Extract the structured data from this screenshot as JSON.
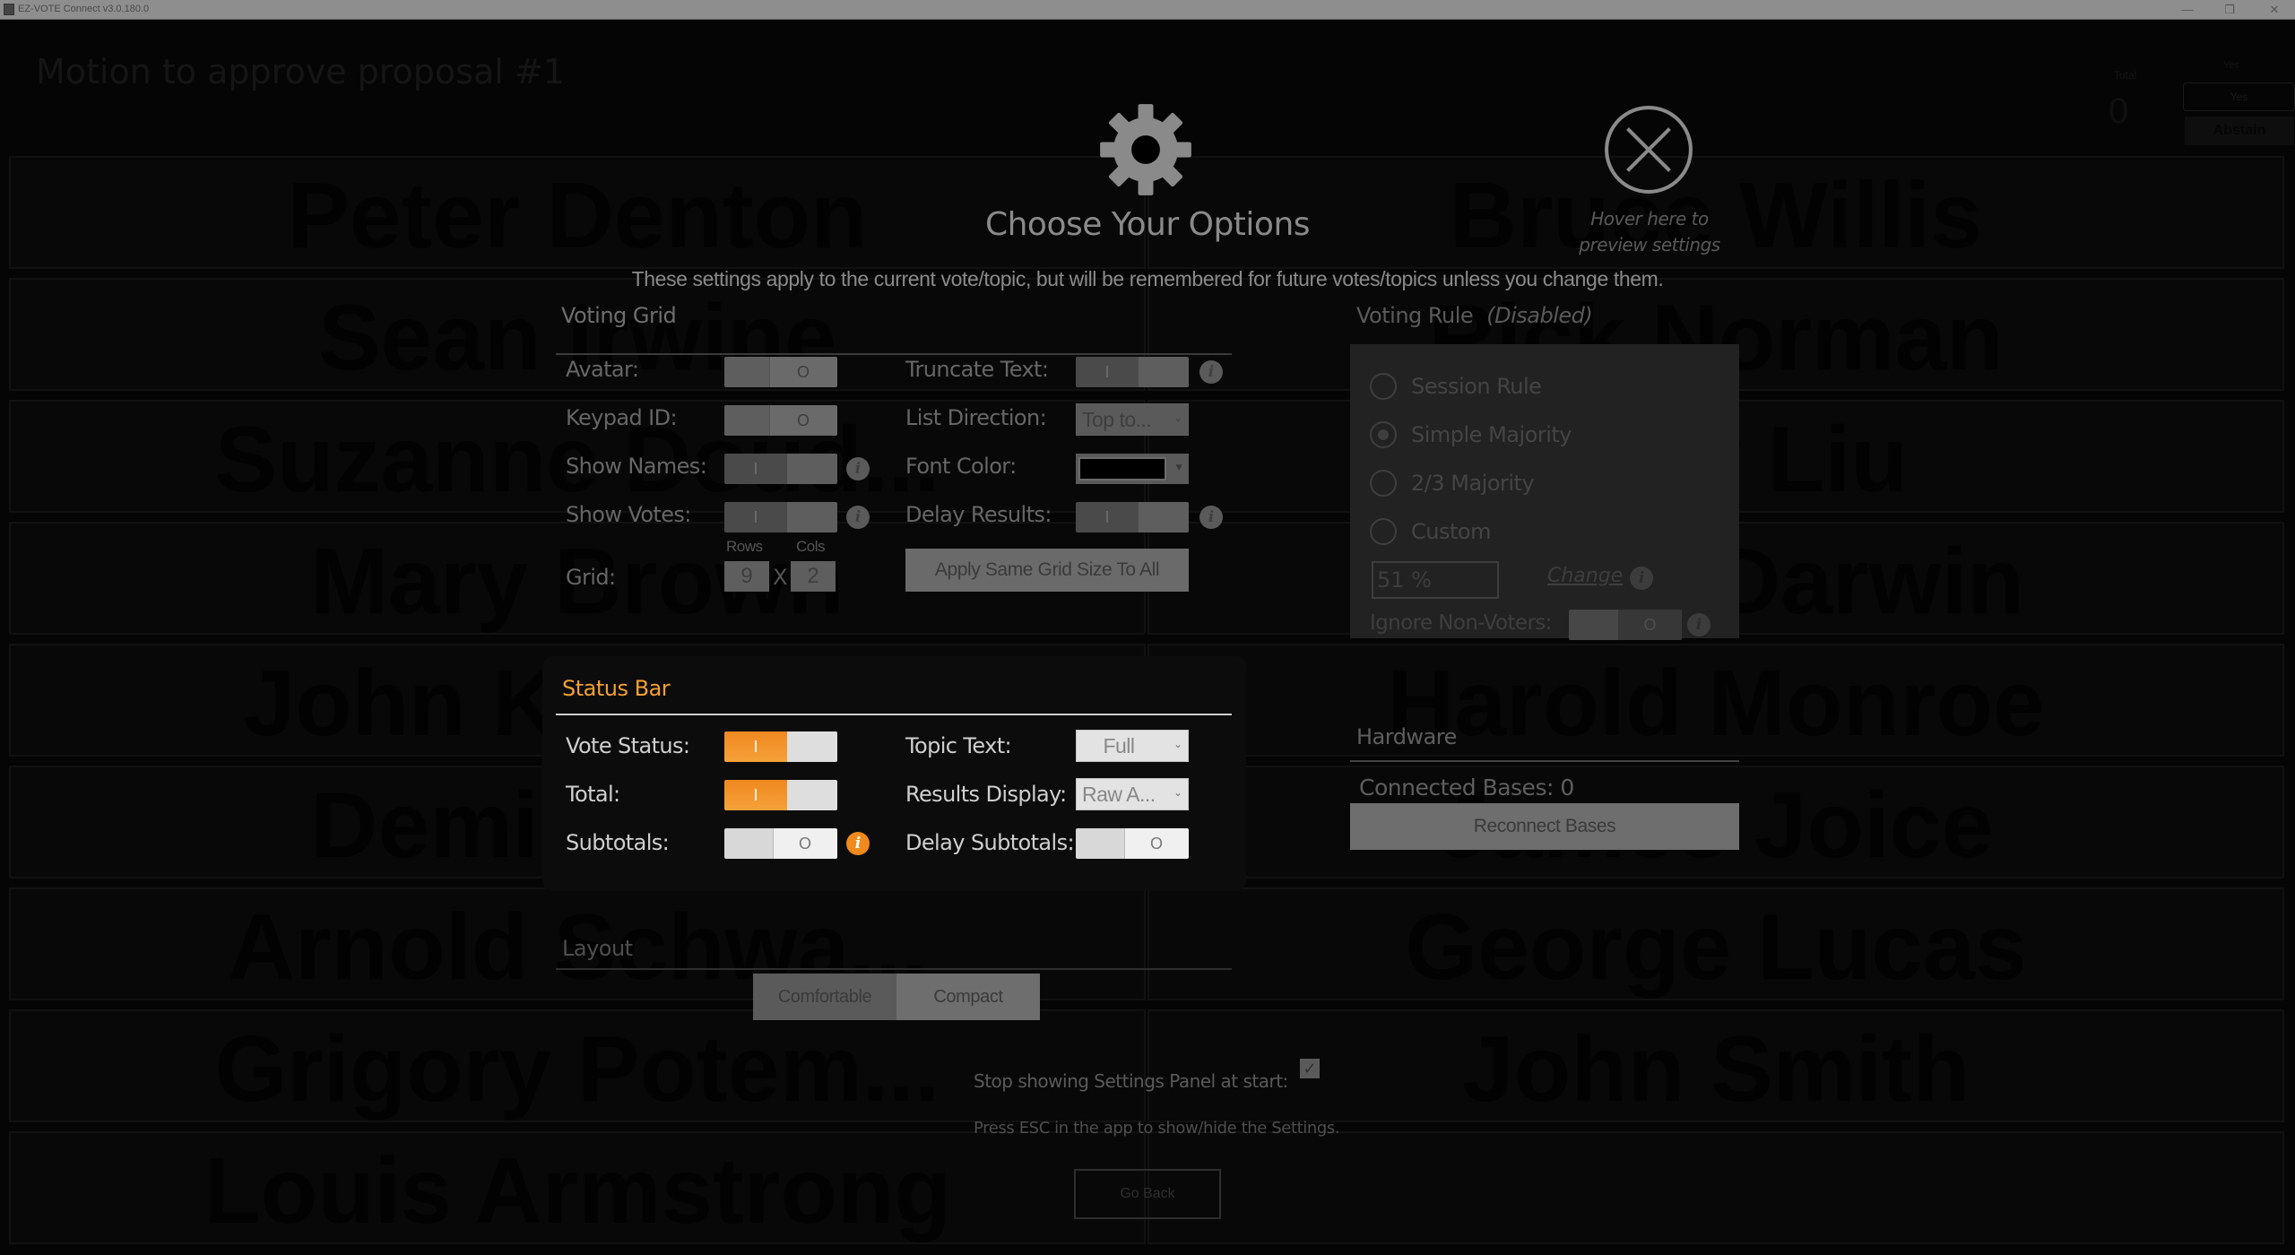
{
  "window": {
    "title": "EZ-VOTE Connect v3.0.180.0",
    "controls": {
      "minimize": "—",
      "maximize": "❐",
      "close": "✕"
    }
  },
  "background_app": {
    "topic": "Motion to approve proposal #1",
    "status": {
      "total_label": "Total",
      "total_value": "0",
      "yes_label": "Yes",
      "yes_field": "Yes",
      "abstain_label": "Abstain"
    },
    "grid_names_left": [
      "Peter Denton",
      "Sean Irwine",
      "Suzanne Doud...",
      "Mary Brown",
      "John Krasinski",
      "Demi Moore",
      "Arnold Schwa...",
      "Grigory Potem...",
      "Louis Armstrong"
    ],
    "grid_names_right": [
      "Bruce Willis",
      "Rick Norman",
      "Lucy Liu",
      "Nancy Darwin",
      "Harold Monroe",
      "James Joice",
      "George Lucas",
      "John Smith",
      ""
    ]
  },
  "settings": {
    "gear_icon": "gear-icon",
    "close_icon": "close-circle-icon",
    "heading": "Choose Your Options",
    "hover_hint": "Hover here to preview settings",
    "subtitle": "These settings apply to the current vote/topic, but will be remembered for future votes/topics unless you change them.",
    "voting_grid": {
      "title": "Voting Grid",
      "avatar": {
        "label": "Avatar:",
        "state": "off",
        "glyph": "O"
      },
      "keypad_id": {
        "label": "Keypad ID:",
        "state": "off",
        "glyph": "O"
      },
      "show_names": {
        "label": "Show Names:",
        "state": "on",
        "glyph": "I"
      },
      "show_votes": {
        "label": "Show Votes:",
        "state": "on",
        "glyph": "I"
      },
      "grid": {
        "label": "Grid:",
        "rows_label": "Rows",
        "cols_label": "Cols",
        "rows": "9",
        "cols": "2",
        "times": "X"
      },
      "truncate_text": {
        "label": "Truncate Text:",
        "state": "on",
        "glyph": "I"
      },
      "list_direction": {
        "label": "List Direction:",
        "value": "Top to..."
      },
      "font_color": {
        "label": "Font Color:",
        "value": "#000000"
      },
      "delay_results": {
        "label": "Delay Results:",
        "state": "on",
        "glyph": "I"
      },
      "apply_button": "Apply Same Grid Size To All",
      "info_glyph": "i"
    },
    "status_bar": {
      "title": "Status Bar",
      "title_color": "#f5a030",
      "vote_status": {
        "label": "Vote Status:",
        "state": "on",
        "glyph": "I"
      },
      "total": {
        "label": "Total:",
        "state": "on",
        "glyph": "I"
      },
      "subtotals": {
        "label": "Subtotals:",
        "state": "off",
        "glyph": "O"
      },
      "topic_text": {
        "label": "Topic Text:",
        "value": "Full"
      },
      "results_display": {
        "label": "Results Display:",
        "value": "Raw A..."
      },
      "delay_subtotals": {
        "label": "Delay Subtotals:",
        "state": "off",
        "glyph": "O"
      },
      "accent_color": "#f08a1c"
    },
    "layout": {
      "title": "Layout",
      "options": [
        "Comfortable",
        "Compact"
      ],
      "selected": "Comfortable"
    },
    "voting_rule": {
      "title": "Voting Rule",
      "disabled_note": "(Disabled)",
      "options": [
        "Session Rule",
        "Simple Majority",
        "2/3 Majority",
        "Custom"
      ],
      "selected": "Simple Majority",
      "custom_percent": "51 %",
      "change_link": "Change",
      "ignore_non_voters": {
        "label": "Ignore Non-Voters:",
        "state": "off",
        "glyph": "O"
      }
    },
    "hardware": {
      "title": "Hardware",
      "connected_bases": "Connected Bases: 0",
      "reconnect_button": "Reconnect Bases"
    },
    "stop_showing": {
      "label": "Stop showing Settings Panel at start:",
      "checked": true,
      "check_glyph": "✓"
    },
    "esc_hint": "Press ESC in the app to show/hide the Settings.",
    "go_back_button": "Go Back"
  }
}
